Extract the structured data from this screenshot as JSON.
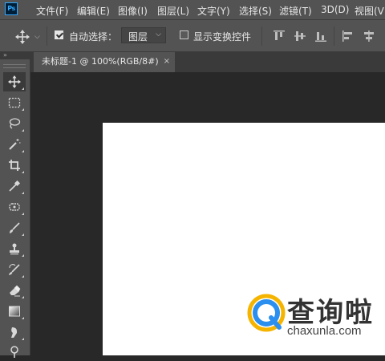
{
  "app": {
    "logo_text": "Ps"
  },
  "menu": [
    {
      "label": "文件(F)"
    },
    {
      "label": "编辑(E)"
    },
    {
      "label": "图像(I)"
    },
    {
      "label": "图层(L)"
    },
    {
      "label": "文字(Y)"
    },
    {
      "label": "选择(S)"
    },
    {
      "label": "滤镜(T)"
    },
    {
      "label": "3D(D)"
    },
    {
      "label": "视图(V"
    }
  ],
  "options": {
    "auto_select_label": "自动选择：",
    "auto_select_checked": true,
    "auto_select_target": "图层",
    "show_transform_label": "显示变换控件",
    "show_transform_checked": false
  },
  "panel_collapse": "»",
  "document_tab": {
    "title": "未标题-1 @ 100%(RGB/8#)",
    "close": "×"
  },
  "tools": [
    {
      "icon": "move-icon",
      "active": true
    },
    {
      "icon": "rect-marquee-icon"
    },
    {
      "icon": "lasso-icon"
    },
    {
      "icon": "magic-wand-icon"
    },
    {
      "icon": "crop-icon"
    },
    {
      "icon": "eyedropper-icon"
    },
    {
      "icon": "spot-healing-icon"
    },
    {
      "icon": "brush-icon"
    },
    {
      "icon": "clone-stamp-icon"
    },
    {
      "icon": "history-brush-icon"
    },
    {
      "icon": "eraser-icon"
    },
    {
      "icon": "gradient-icon"
    },
    {
      "icon": "smudge-icon"
    },
    {
      "icon": "dodge-icon"
    }
  ],
  "watermark": {
    "cn": "查询啦",
    "en": "chaxunla.com",
    "accent_color": "#2b8ff0",
    "ring_color": "#f5b400"
  },
  "colors": {
    "ui_panel": "#535353",
    "ui_dark": "#282828",
    "canvas": "#ffffff"
  }
}
